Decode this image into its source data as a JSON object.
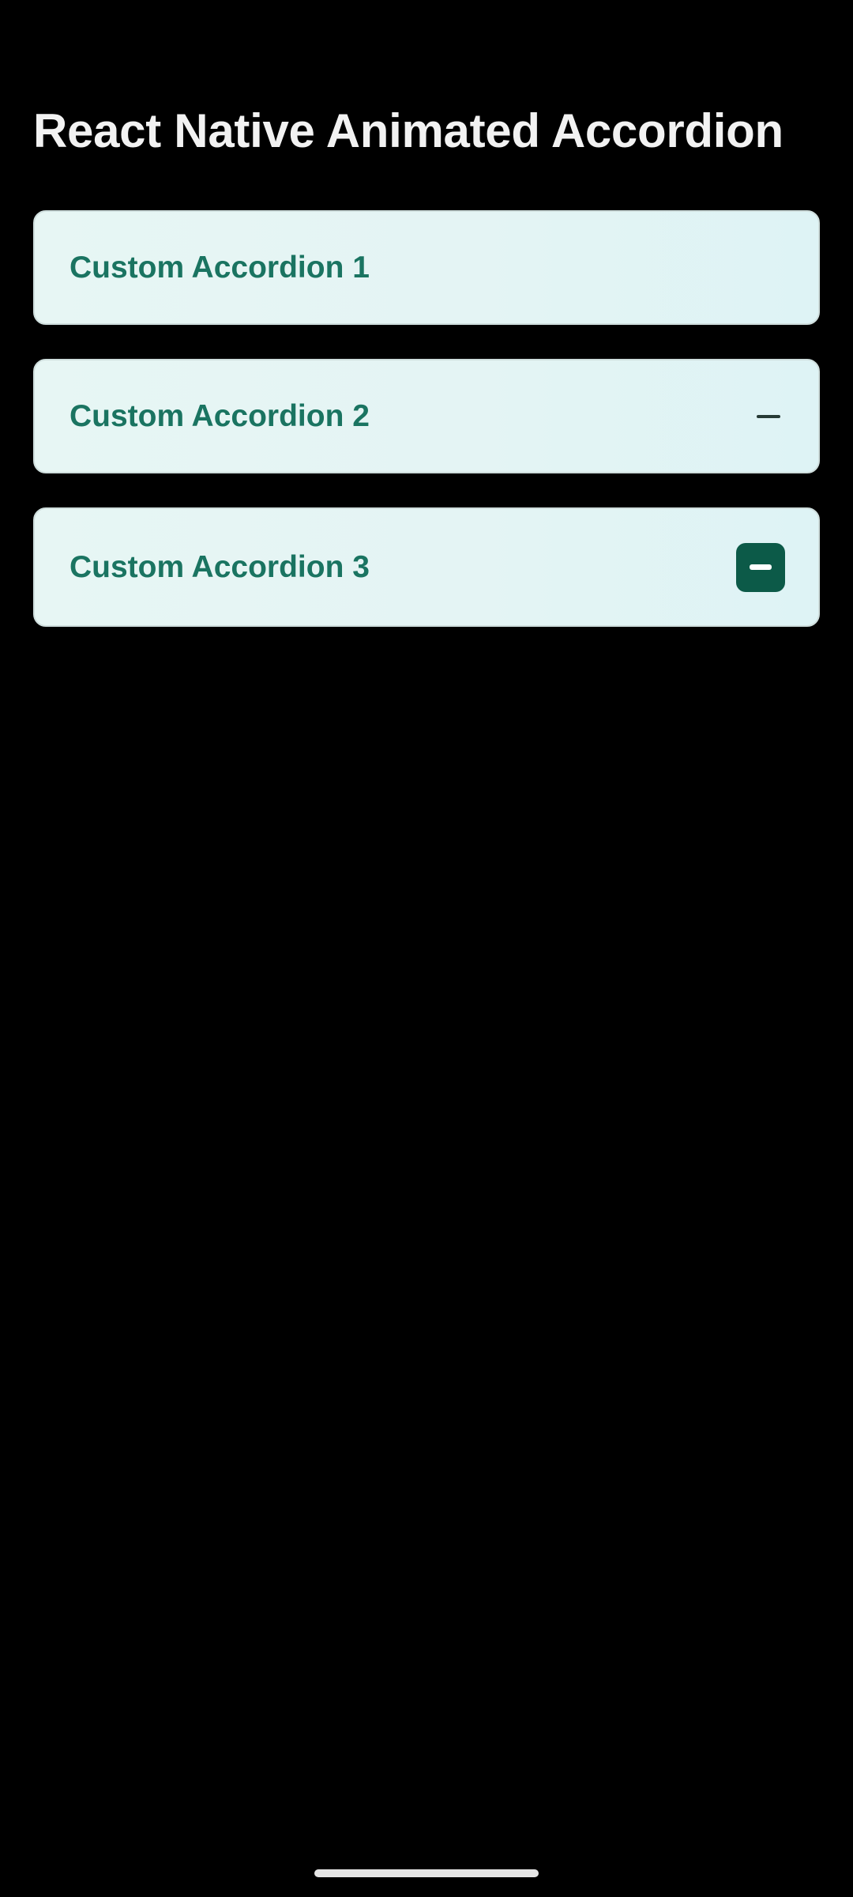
{
  "app": {
    "title": "React Native Animated Accordion"
  },
  "accordions": [
    {
      "label": "Custom Accordion 1",
      "icon": "none"
    },
    {
      "label": "Custom Accordion 2",
      "icon": "minus-icon"
    },
    {
      "label": "Custom Accordion 3",
      "icon": "minus-square-icon"
    }
  ],
  "colors": {
    "background": "#000000",
    "title": "#f2f2f2",
    "accordion_bg": "#e4f4f4",
    "accordion_border": "#cfdedd",
    "label": "#1a7461",
    "icon_dark": "#0c5a48"
  }
}
